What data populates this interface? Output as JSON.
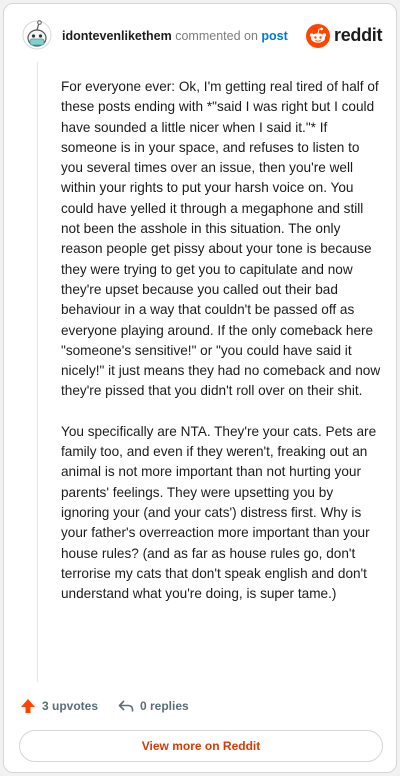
{
  "comment": {
    "username": "idontevenlikethem",
    "action_text": "commented on",
    "post_link": "post",
    "paragraphs": [
      "For everyone ever: Ok, I'm getting real tired of half of these posts ending with *\"said I was right but I could have sounded a little nicer when I said it.\"* If someone is in your space, and refuses to listen to you several times over an issue, then you're well within your rights to put your harsh voice on. You could have yelled it through a megaphone and still not been the asshole in this situation. The only reason people get pissy about your tone is because they were trying to get you to capitulate and now they're upset because you called out their bad behaviour in a way that couldn't be passed off as everyone playing around. If the only comeback here \"someone's sensitive!\" or \"you could have said it nicely!\" it just means they had no comeback and now they're pissed that you didn't roll over on their shit.",
      "You specifically are NTA. They're your cats. Pets are family too, and even if they weren't, freaking out an animal is not more important than not hurting your parents' feelings. They were upsetting you by ignoring your (and your cats') distress first. Why is your father's overreaction more important than your house rules? (and as far as house rules go, don't terrorise my cats that don't speak english and don't understand what you're doing, is super tame.)"
    ],
    "upvotes": "3 upvotes",
    "replies": "0 replies"
  },
  "brand": {
    "name": "reddit",
    "color": "#ff4500"
  },
  "view_more_label": "View more on Reddit",
  "colors": {
    "upvote": "#ff4500",
    "link": "#0079d3",
    "view_more": "#d93a00"
  },
  "icons": [
    "avatar",
    "reddit-logo-icon",
    "upvote-arrow-icon",
    "reply-arrow-icon"
  ]
}
